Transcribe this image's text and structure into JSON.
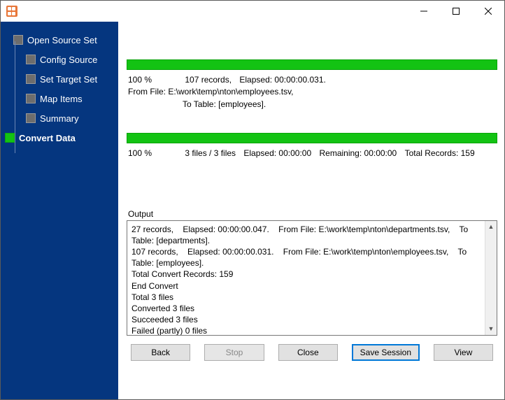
{
  "sidebar": {
    "items": [
      {
        "label": "Open Source Set",
        "child": false,
        "active": false
      },
      {
        "label": "Config Source",
        "child": true,
        "active": false
      },
      {
        "label": "Set Target Set",
        "child": true,
        "active": false
      },
      {
        "label": "Map Items",
        "child": true,
        "active": false
      },
      {
        "label": "Summary",
        "child": true,
        "active": false
      },
      {
        "label": "Convert Data",
        "child": false,
        "active": true
      }
    ]
  },
  "progress1": {
    "percent_label": "100 %",
    "records": "107 records,",
    "elapsed": "Elapsed: 00:00:00.031.",
    "from": "From File: E:\\work\\temp\\nton\\employees.tsv,",
    "to": "To Table: [employees]."
  },
  "progress2": {
    "percent_label": "100 %",
    "files": "3 files / 3 files",
    "elapsed": "Elapsed: 00:00:00",
    "remaining": "Remaining: 00:00:00",
    "total": "Total Records: 159"
  },
  "output_label": "Output",
  "output_text": "27 records,    Elapsed: 00:00:00.047.    From File: E:\\work\\temp\\nton\\departments.tsv,    To Table: [departments].\n107 records,    Elapsed: 00:00:00.031.    From File: E:\\work\\temp\\nton\\employees.tsv,    To Table: [employees].\nTotal Convert Records: 159\nEnd Convert\nTotal 3 files\nConverted 3 files\nSucceeded 3 files\nFailed (partly) 0 files",
  "buttons": {
    "back": "Back",
    "stop": "Stop",
    "close": "Close",
    "save": "Save Session",
    "view": "View"
  }
}
